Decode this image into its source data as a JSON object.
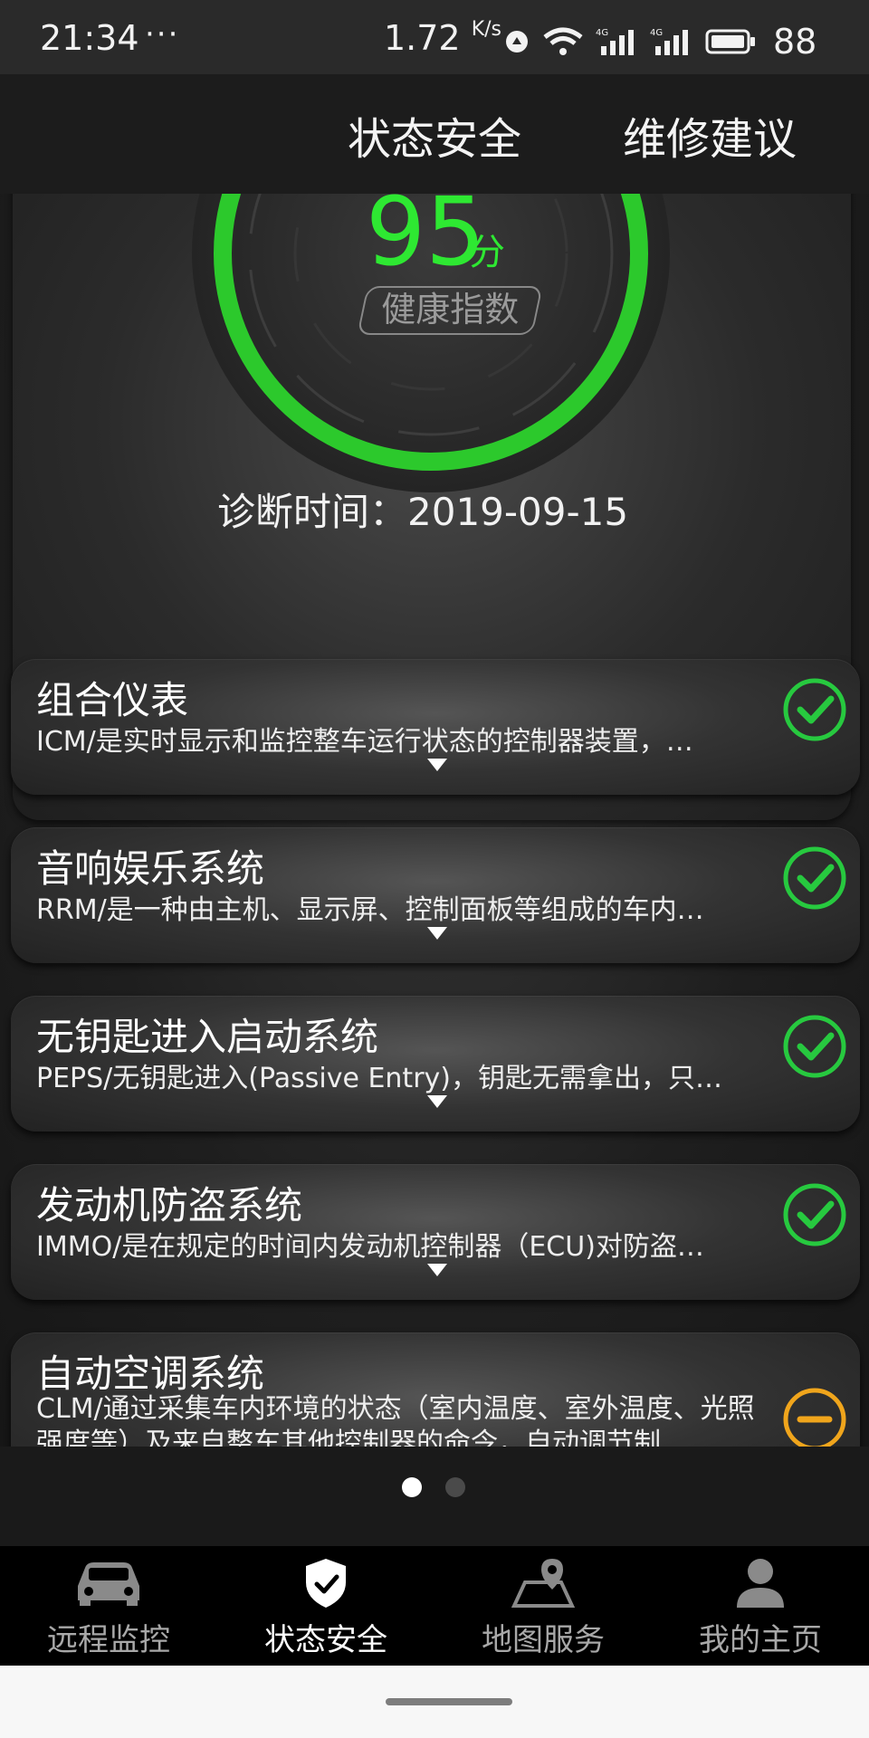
{
  "status_bar": {
    "time": "21:34",
    "more": "···",
    "net_speed": "1.72",
    "net_unit": "K/s",
    "battery": "88"
  },
  "top_tabs": {
    "status_safety": "状态安全",
    "repair_advice": "维修建议"
  },
  "score": {
    "value": "95",
    "unit": "分",
    "label": "健康指数",
    "fraction": 0.95,
    "diagnosis_time": "诊断时间：2019-09-15"
  },
  "systems": [
    {
      "title": "组合仪表",
      "desc": "ICM/是实时显示和监控整车运行状态的控制器装置，…",
      "status": "ok"
    },
    {
      "title": "音响娱乐系统",
      "desc": "RRM/是一种由主机、显示屏、控制面板等组成的车内…",
      "status": "ok"
    },
    {
      "title": "无钥匙进入启动系统",
      "desc": "PEPS/无钥匙进入(Passive Entry)，钥匙无需拿出，只…",
      "status": "ok"
    },
    {
      "title": "发动机防盗系统",
      "desc": "IMMO/是在规定的时间内发动机控制器（ECU)对防盗…",
      "status": "ok"
    },
    {
      "title": "自动空调系统",
      "desc": "CLM/通过采集车内环境的状态（室内温度、室外温度、光照强度等）及来自整车其他控制器的命令，自动调节制",
      "status": "warning"
    }
  ],
  "bottom_nav": {
    "remote": "远程监控",
    "safety": "状态安全",
    "map": "地图服务",
    "home": "我的主页"
  },
  "colors": {
    "score_green": "#2ee832",
    "ok_green": "#27c93f",
    "warn_orange": "#f0a51c"
  }
}
